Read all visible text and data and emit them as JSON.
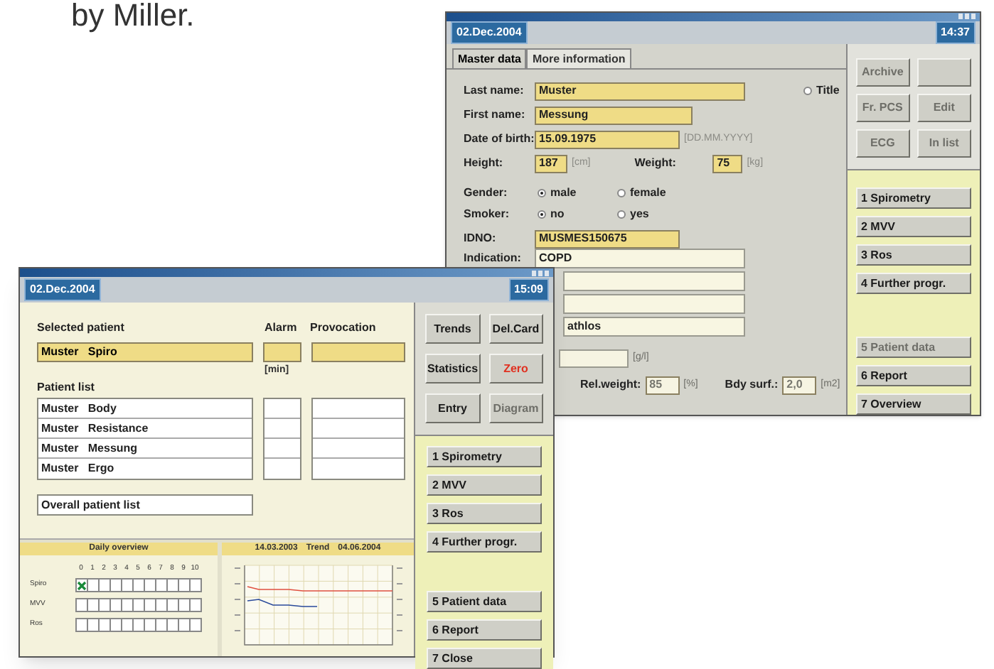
{
  "caption": "by Miller.",
  "back_window": {
    "date": "02.Dec.2004",
    "time": "14:37",
    "tabs": [
      {
        "label": "Master data",
        "selected": true
      },
      {
        "label": "More information",
        "selected": false
      }
    ],
    "last_name": {
      "label": "Last name:",
      "value": "Muster"
    },
    "title_option": {
      "label": "Title",
      "selected": false
    },
    "first_name": {
      "label": "First name:",
      "value": "Messung"
    },
    "date_of_birth": {
      "label": "Date of birth:",
      "value": "15.09.1975",
      "hint": "[DD.MM.YYYY]"
    },
    "height": {
      "label": "Height:",
      "value": "187",
      "unit": "[cm]"
    },
    "weight": {
      "label": "Weight:",
      "value": "75",
      "unit": "[kg]"
    },
    "gender": {
      "label": "Gender:",
      "options": [
        {
          "label": "male",
          "selected": true
        },
        {
          "label": "female",
          "selected": false
        }
      ]
    },
    "smoker": {
      "label": "Smoker:",
      "options": [
        {
          "label": "no",
          "selected": true
        },
        {
          "label": "yes",
          "selected": false
        }
      ]
    },
    "idno": {
      "label": "IDNO:",
      "value": "MUSMES150675"
    },
    "indication": {
      "label": "Indication:",
      "line_1": "COPD",
      "line_4": "athlos"
    },
    "lab_unit": {
      "unit": "[g/l]",
      "disabled": true
    },
    "rel_weight": {
      "label": "Rel.weight:",
      "value": "85",
      "unit": "[%]",
      "disabled": true
    },
    "body_surface": {
      "label": "Bdy surf.:",
      "value": "2,0",
      "unit": "[m2]",
      "disabled": true
    },
    "tools": [
      {
        "label": "Archive",
        "disabled": true
      },
      {
        "label": "Fr. PCS",
        "disabled": true
      },
      {
        "label": "Edit",
        "disabled": true
      },
      {
        "label": "ECG",
        "disabled": true
      },
      {
        "label": "In list",
        "disabled": true
      }
    ],
    "programs": [
      {
        "label": "1 Spirometry",
        "disabled": false
      },
      {
        "label": "2 MVV",
        "disabled": false
      },
      {
        "label": "3 Ros",
        "disabled": false
      },
      {
        "label": "4 Further progr.",
        "disabled": false
      }
    ],
    "actions": [
      {
        "label": "5 Patient data",
        "disabled": true
      },
      {
        "label": "6 Report",
        "disabled": false
      },
      {
        "label": "7 Overview",
        "disabled": false
      }
    ]
  },
  "front_window": {
    "date": "02.Dec.2004",
    "time": "15:09",
    "selected_patient_label": "Selected patient",
    "alarm_label": "Alarm",
    "provocation_label": "Provocation",
    "selected_patient": "Muster   Spiro",
    "alarm_unit": "[min]",
    "patient_list_label": "Patient list",
    "patients": [
      {
        "name": "Muster   Body"
      },
      {
        "name": "Muster   Resistance"
      },
      {
        "name": "Muster   Messung"
      },
      {
        "name": "Muster   Ergo"
      }
    ],
    "overall_button": "Overall patient list",
    "tools": [
      {
        "label": "Trends",
        "kind": "normal",
        "disabled": false
      },
      {
        "label": "Del.Card",
        "kind": "normal",
        "disabled": false
      },
      {
        "label": "Statistics",
        "kind": "normal",
        "disabled": false
      },
      {
        "label": "Zero",
        "kind": "alert",
        "disabled": false
      },
      {
        "label": "Entry",
        "kind": "normal",
        "disabled": false
      },
      {
        "label": "Diagram",
        "kind": "normal",
        "disabled": true
      }
    ],
    "programs": [
      {
        "label": "1 Spirometry",
        "disabled": false
      },
      {
        "label": "2 MVV",
        "disabled": false
      },
      {
        "label": "3 Ros",
        "disabled": false
      },
      {
        "label": "4 Further progr."
      }
    ],
    "actions": [
      {
        "label": "5 Patient data",
        "disabled": false
      },
      {
        "label": "6 Report",
        "disabled": false
      },
      {
        "label": "7 Close",
        "disabled": false
      }
    ],
    "daily_overview": {
      "title": "Daily overview",
      "columns": [
        "0",
        "1",
        "2",
        "3",
        "4",
        "5",
        "6",
        "7",
        "8",
        "9",
        "10"
      ],
      "rows": [
        {
          "label": "Spiro",
          "days": [
            {
              "checked": true
            },
            {
              "checked": false
            },
            {
              "checked": false
            },
            {
              "checked": false
            },
            {
              "checked": false
            },
            {
              "checked": false
            },
            {
              "checked": false
            },
            {
              "checked": false
            },
            {
              "checked": false
            },
            {
              "checked": false
            },
            {
              "checked": false
            }
          ]
        },
        {
          "label": "MVV",
          "days": [
            {
              "checked": false
            },
            {
              "checked": false
            },
            {
              "checked": false
            },
            {
              "checked": false
            },
            {
              "checked": false
            },
            {
              "checked": false
            },
            {
              "checked": false
            },
            {
              "checked": false
            },
            {
              "checked": false
            },
            {
              "checked": false
            },
            {
              "checked": false
            }
          ]
        },
        {
          "label": "Ros",
          "days": [
            {
              "checked": false
            },
            {
              "checked": false
            },
            {
              "checked": false
            },
            {
              "checked": false
            },
            {
              "checked": false
            },
            {
              "checked": false
            },
            {
              "checked": false
            },
            {
              "checked": false
            },
            {
              "checked": false
            },
            {
              "checked": false
            },
            {
              "checked": false
            }
          ]
        }
      ]
    },
    "trend": {
      "start": "14.03.2003",
      "label": "Trend",
      "end": "04.06.2004"
    }
  }
}
